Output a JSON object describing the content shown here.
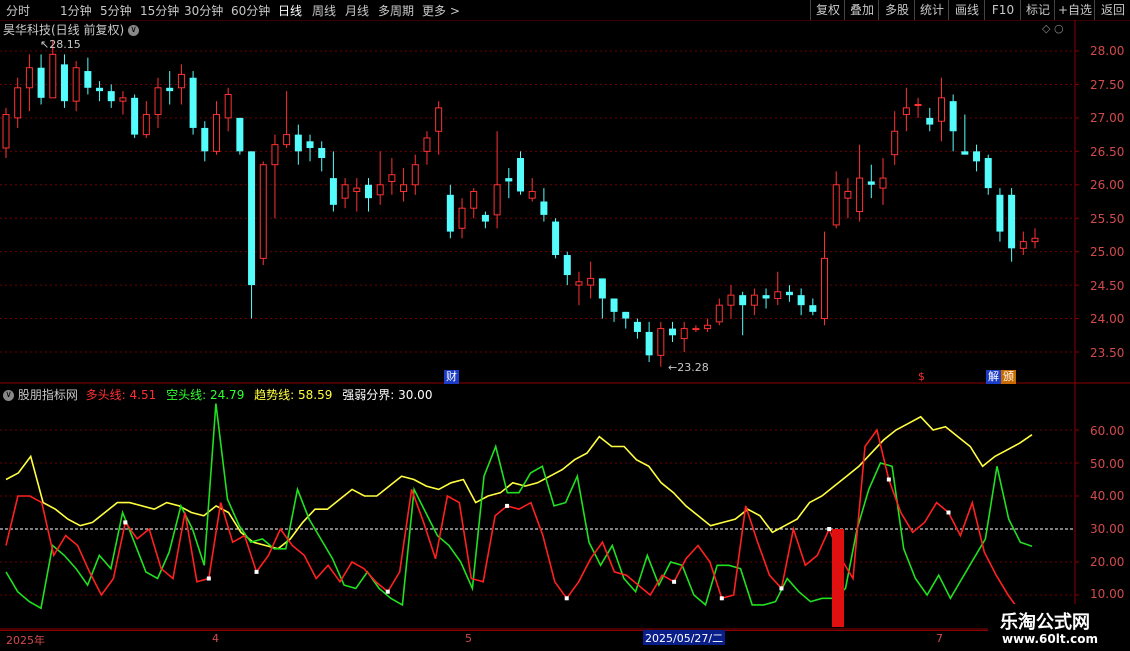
{
  "toolbar": {
    "periods": [
      "分时",
      "1分钟",
      "5分钟",
      "15分钟",
      "30分钟",
      "60分钟",
      "日线",
      "周线",
      "月线",
      "多周期",
      "更多"
    ],
    "active": "日线",
    "right_buttons": [
      "复权",
      "叠加",
      "多股",
      "统计",
      "画线",
      "F10",
      "标记",
      "+自选",
      "返回"
    ]
  },
  "main_panel": {
    "title": "昊华科技(日线 前复权)",
    "high_label": "28.15",
    "low_label": "23.28",
    "price_ticks": [
      "28.00",
      "27.50",
      "27.00",
      "26.50",
      "26.00",
      "25.50",
      "25.00",
      "24.50",
      "24.00",
      "23.50"
    ],
    "badges": {
      "cai": "财",
      "dollar": "$",
      "jie": "解",
      "jin": "颁"
    }
  },
  "indicator_panel": {
    "name": "股朋指标网",
    "long_label": "多头线:",
    "long_value": "4.51",
    "short_label": "空头线:",
    "short_value": "24.79",
    "trend_label": "趋势线:",
    "trend_value": "58.59",
    "threshold_label": "强弱分界:",
    "threshold_value": "30.00",
    "ticks": [
      "60.00",
      "50.00",
      "40.00",
      "30.00",
      "20.00",
      "10.00"
    ]
  },
  "date_axis": {
    "year": "2025年",
    "month_4": "4",
    "month_5": "5",
    "cursor_date": "2025/05/27/二",
    "month_7": "7"
  },
  "watermark": {
    "line1": "乐淘公式网",
    "line2": "www.60lt.com"
  },
  "colors": {
    "up": "#ff3232",
    "down": "#54fcfc",
    "long": "#ff2020",
    "short": "#20e020",
    "trend": "#ffff40",
    "grid": "#8b0000"
  },
  "chart_data": {
    "type": "candlestick",
    "y_range": [
      23.2,
      28.3
    ],
    "candles": [
      [
        26.55,
        27.05,
        27.15,
        26.4
      ],
      [
        27.0,
        27.45,
        27.6,
        26.85
      ],
      [
        27.45,
        27.75,
        27.95,
        27.1
      ],
      [
        27.75,
        27.3,
        27.95,
        27.2
      ],
      [
        27.3,
        27.95,
        28.15,
        27.3
      ],
      [
        27.8,
        27.25,
        27.95,
        27.15
      ],
      [
        27.25,
        27.75,
        27.85,
        27.1
      ],
      [
        27.7,
        27.45,
        27.9,
        27.35
      ],
      [
        27.45,
        27.4,
        27.55,
        27.25
      ],
      [
        27.4,
        27.25,
        27.5,
        27.15
      ],
      [
        27.25,
        27.3,
        27.4,
        27.05
      ],
      [
        27.3,
        26.75,
        27.35,
        26.7
      ],
      [
        26.75,
        27.05,
        27.25,
        26.7
      ],
      [
        27.05,
        27.45,
        27.6,
        26.85
      ],
      [
        27.45,
        27.4,
        27.7,
        27.2
      ],
      [
        27.45,
        27.65,
        27.8,
        27.2
      ],
      [
        27.6,
        26.85,
        27.7,
        26.75
      ],
      [
        26.85,
        26.5,
        26.95,
        26.35
      ],
      [
        26.5,
        27.05,
        27.25,
        26.45
      ],
      [
        27.0,
        27.35,
        27.45,
        26.8
      ],
      [
        27.0,
        26.5,
        27.0,
        26.45
      ],
      [
        26.5,
        24.5,
        26.5,
        24.0
      ],
      [
        24.9,
        26.3,
        26.35,
        24.8
      ],
      [
        26.3,
        26.6,
        26.75,
        25.5
      ],
      [
        26.6,
        26.75,
        27.4,
        26.55
      ],
      [
        26.75,
        26.5,
        26.9,
        26.3
      ],
      [
        26.65,
        26.55,
        26.75,
        26.35
      ],
      [
        26.55,
        26.4,
        26.65,
        26.2
      ],
      [
        26.1,
        25.7,
        26.5,
        25.6
      ],
      [
        25.8,
        26.0,
        26.1,
        25.65
      ],
      [
        25.9,
        25.95,
        26.1,
        25.6
      ],
      [
        26.0,
        25.8,
        26.1,
        25.6
      ],
      [
        25.85,
        26.0,
        26.5,
        25.7
      ],
      [
        26.05,
        26.15,
        26.4,
        25.85
      ],
      [
        25.9,
        26.0,
        26.25,
        25.75
      ],
      [
        26.0,
        26.3,
        26.45,
        25.85
      ],
      [
        26.5,
        26.7,
        26.8,
        26.3
      ],
      [
        26.8,
        27.15,
        27.25,
        26.45
      ],
      [
        25.85,
        25.3,
        26.0,
        25.2
      ],
      [
        25.35,
        25.65,
        25.8,
        25.2
      ],
      [
        25.65,
        25.9,
        25.95,
        25.5
      ],
      [
        25.55,
        25.45,
        25.6,
        25.35
      ],
      [
        25.55,
        26.0,
        26.8,
        25.35
      ],
      [
        26.1,
        26.05,
        26.25,
        25.8
      ],
      [
        26.4,
        25.9,
        26.5,
        25.85
      ],
      [
        25.8,
        25.9,
        26.1,
        25.75
      ],
      [
        25.75,
        25.55,
        25.95,
        25.45
      ],
      [
        25.45,
        24.95,
        25.5,
        24.9
      ],
      [
        24.95,
        24.65,
        25.0,
        24.5
      ],
      [
        24.5,
        24.55,
        24.7,
        24.2
      ],
      [
        24.5,
        24.6,
        24.85,
        24.3
      ],
      [
        24.6,
        24.3,
        24.6,
        24.0
      ],
      [
        24.3,
        24.1,
        24.3,
        23.95
      ],
      [
        24.1,
        24.0,
        24.1,
        23.85
      ],
      [
        23.95,
        23.8,
        24.0,
        23.7
      ],
      [
        23.8,
        23.45,
        23.95,
        23.35
      ],
      [
        23.45,
        23.85,
        23.95,
        23.28
      ],
      [
        23.85,
        23.75,
        23.95,
        23.65
      ],
      [
        23.7,
        23.85,
        23.95,
        23.5
      ],
      [
        23.85,
        23.85,
        23.9,
        23.8
      ],
      [
        23.85,
        23.9,
        24.0,
        23.8
      ],
      [
        23.95,
        24.2,
        24.3,
        23.9
      ],
      [
        24.2,
        24.35,
        24.5,
        24.0
      ],
      [
        24.35,
        24.2,
        24.4,
        23.75
      ],
      [
        24.2,
        24.35,
        24.45,
        24.05
      ],
      [
        24.35,
        24.3,
        24.45,
        24.15
      ],
      [
        24.3,
        24.4,
        24.7,
        24.2
      ],
      [
        24.4,
        24.35,
        24.5,
        24.25
      ],
      [
        24.35,
        24.2,
        24.45,
        24.05
      ],
      [
        24.2,
        24.1,
        24.3,
        24.05
      ],
      [
        24.0,
        24.9,
        25.3,
        23.9
      ],
      [
        25.4,
        26.0,
        26.2,
        25.35
      ],
      [
        25.8,
        25.9,
        26.1,
        25.5
      ],
      [
        25.6,
        26.1,
        26.6,
        25.45
      ],
      [
        26.05,
        26.0,
        26.3,
        25.8
      ],
      [
        25.95,
        26.1,
        26.4,
        25.7
      ],
      [
        26.45,
        26.8,
        27.1,
        26.3
      ],
      [
        27.05,
        27.15,
        27.45,
        26.8
      ],
      [
        27.2,
        27.2,
        27.3,
        27.0
      ],
      [
        27.0,
        26.9,
        27.15,
        26.8
      ],
      [
        26.95,
        27.3,
        27.6,
        26.65
      ],
      [
        27.25,
        26.8,
        27.35,
        26.5
      ],
      [
        26.5,
        26.45,
        27.05,
        26.45
      ],
      [
        26.5,
        26.35,
        26.6,
        26.2
      ],
      [
        26.4,
        25.95,
        26.45,
        25.85
      ],
      [
        25.85,
        25.3,
        25.95,
        25.15
      ],
      [
        25.85,
        25.05,
        25.95,
        24.85
      ],
      [
        25.05,
        25.15,
        25.3,
        24.95
      ],
      [
        25.15,
        25.2,
        25.35,
        25.05
      ]
    ],
    "indicator": {
      "y_range": [
        0,
        70
      ],
      "threshold": 30,
      "long_line": [
        25,
        40,
        40,
        38,
        22,
        28,
        25,
        17,
        10,
        15,
        32,
        27,
        30,
        18,
        15,
        35,
        14,
        15,
        38,
        26,
        28,
        17,
        22,
        30,
        25,
        22,
        15,
        19,
        14,
        20,
        18,
        14,
        11,
        17,
        42,
        32,
        21,
        40,
        38,
        15,
        14,
        34,
        37,
        36,
        38,
        28,
        14,
        9,
        14,
        21,
        26,
        17,
        16,
        13,
        10,
        16,
        14,
        21,
        25,
        20,
        9,
        10,
        37,
        26,
        16,
        12,
        30,
        19,
        22,
        30,
        21,
        15,
        55,
        60,
        45,
        35,
        29,
        32,
        38,
        35,
        28,
        38,
        23,
        16,
        10,
        5,
        4.5
      ],
      "short_line": [
        17,
        11,
        8,
        6,
        25,
        22,
        18,
        13,
        22,
        18,
        35,
        26,
        17,
        15,
        23,
        37,
        30,
        19,
        68,
        39,
        31,
        26,
        27,
        24,
        24,
        42,
        33,
        27,
        21,
        13,
        12,
        17,
        12,
        9,
        7,
        42,
        35,
        28,
        25,
        20,
        12,
        46,
        55,
        41,
        41,
        47,
        49,
        37,
        38,
        46,
        26,
        19,
        25,
        15,
        11,
        22,
        13,
        20,
        19,
        10,
        7,
        19,
        19,
        18,
        7,
        7,
        8,
        15,
        11,
        8,
        9,
        9,
        12,
        30,
        42,
        50,
        49,
        24,
        15,
        10,
        16,
        9,
        15,
        21,
        27,
        49,
        33,
        26,
        24.79
      ],
      "trend_line": [
        45,
        47,
        52,
        38,
        36,
        33,
        31,
        32,
        35,
        38,
        38,
        37,
        36,
        38,
        37,
        35,
        34,
        37,
        35,
        29,
        26,
        25,
        24,
        27,
        32,
        36,
        36,
        39,
        42,
        40,
        40,
        43,
        46,
        45,
        43,
        42,
        44,
        45,
        38,
        40,
        41,
        44,
        43,
        44,
        46,
        48,
        51,
        53,
        58,
        55,
        55,
        51,
        49,
        44,
        41,
        37,
        34,
        31,
        32,
        33,
        36,
        34,
        29,
        31,
        33,
        38,
        40,
        43,
        46,
        49,
        53,
        57,
        60,
        62,
        64,
        60,
        61,
        58,
        55,
        49,
        52,
        54,
        56,
        58.59
      ]
    }
  }
}
